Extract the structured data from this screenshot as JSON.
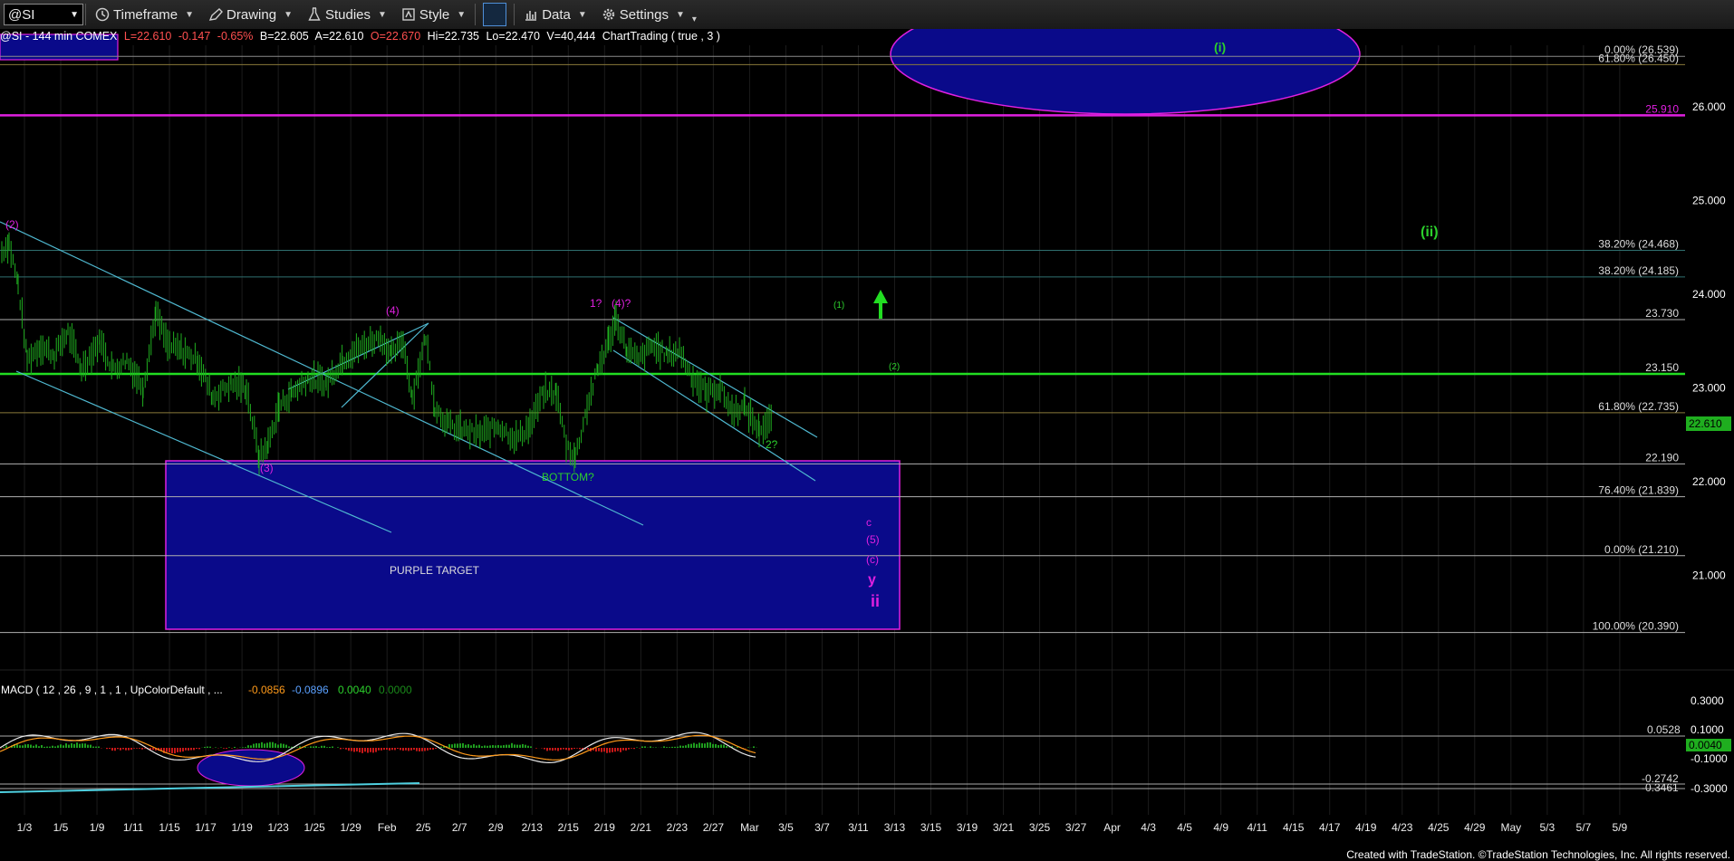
{
  "toolbar": {
    "symbol": "@SI",
    "buttons": [
      {
        "label": "Timeframe",
        "icon": "clock-icon"
      },
      {
        "label": "Drawing",
        "icon": "pencil-icon"
      },
      {
        "label": "Studies",
        "icon": "flask-icon"
      },
      {
        "label": "Style",
        "icon": "style-icon"
      },
      {
        "label": "Data",
        "icon": "bar-chart-icon"
      },
      {
        "label": "Settings",
        "icon": "gear-icon"
      }
    ]
  },
  "infobar": {
    "title": "@SI - 144 min  COMEX",
    "last": "L=22.610",
    "change": "-0.147",
    "change_pct": "-0.65%",
    "bid": "B=22.605",
    "ask": "A=22.610",
    "open": "O=22.670",
    "high": "Hi=22.735",
    "low": "Lo=22.470",
    "volume": "V=40,444",
    "study": "ChartTrading ( true , 3 )"
  },
  "price_axis": [
    "26.000",
    "25.000",
    "24.000",
    "23.000",
    "22.000",
    "21.000"
  ],
  "current_price": "22.610",
  "levels": [
    {
      "label": "0.00% (26.539)",
      "price": 26.539,
      "color": "#8a8a8a"
    },
    {
      "label": "61.80% (26.450)",
      "price": 26.45,
      "color": "#8a7a3a"
    },
    {
      "label": "25.910",
      "price": 25.91,
      "color": "#e020e0"
    },
    {
      "label": "38.20% (24.468)",
      "price": 24.468,
      "color": "#2f6f6f"
    },
    {
      "label": "38.20% (24.185)",
      "price": 24.185,
      "color": "#2f6f6f"
    },
    {
      "label": "23.730",
      "price": 23.73,
      "color": "#b0b0b0"
    },
    {
      "label": "23.150",
      "price": 23.15,
      "color": "#22dd22"
    },
    {
      "label": "61.80% (22.735)",
      "price": 22.735,
      "color": "#8a7a3a"
    },
    {
      "label": "22.190",
      "price": 22.19,
      "color": "#b0b0b0"
    },
    {
      "label": "76.40% (21.839)",
      "price": 21.839,
      "color": "#b0b0b0"
    },
    {
      "label": "0.00% (21.210)",
      "price": 21.21,
      "color": "#b0b0b0"
    },
    {
      "label": "100.00% (20.390)",
      "price": 20.39,
      "color": "#b0b0b0"
    }
  ],
  "annotations": {
    "purple_target": "PURPLE TARGET",
    "bottom": "BOTTOM?",
    "wave_2": "(2)",
    "wave_3": "(3)",
    "wave_4a": "(4)",
    "wave_1q": "1?",
    "wave_4q": "(4)?",
    "wave_2q": "2?",
    "green_1": "(1)",
    "green_2": "(2)",
    "green_i": "(i)",
    "green_ii": "(ii)",
    "c": "c",
    "w5": "(5)",
    "wc": "(c)",
    "y": "y",
    "ii": "ii"
  },
  "macd": {
    "title": "MACD ( 12 , 26 , 9 , 1 , 1 , UpColorDefault , ...",
    "v1": "-0.0856",
    "v2": "-0.0896",
    "v3": "0.0040",
    "v4": "0.0000",
    "axis": [
      "0.3000",
      "0.1000",
      "-0.1000",
      "-0.3000"
    ],
    "tag_upper": "0.0528",
    "tag_current": "0.0040",
    "tag_lower1": "-0.2742",
    "tag_lower2": "-0.3461"
  },
  "date_axis": [
    "1/3",
    "1/5",
    "1/9",
    "1/11",
    "1/15",
    "1/17",
    "1/19",
    "1/23",
    "1/25",
    "1/29",
    "Feb",
    "2/5",
    "2/7",
    "2/9",
    "2/13",
    "2/15",
    "2/19",
    "2/21",
    "2/23",
    "2/27",
    "Mar",
    "3/5",
    "3/7",
    "3/11",
    "3/13",
    "3/15",
    "3/19",
    "3/21",
    "3/25",
    "3/27",
    "Apr",
    "4/3",
    "4/5",
    "4/9",
    "4/11",
    "4/15",
    "4/17",
    "4/19",
    "4/23",
    "4/25",
    "4/29",
    "May",
    "5/3",
    "5/7",
    "5/9"
  ],
  "footer": "Created with TradeStation. ©TradeStation Technologies, Inc. All rights reserved.",
  "colors": {
    "price": "#1fae1f",
    "channel": "#4fb8d0",
    "magenta": "#e020e0",
    "green": "#22dd22",
    "target_fill": "#0a0a8a"
  }
}
